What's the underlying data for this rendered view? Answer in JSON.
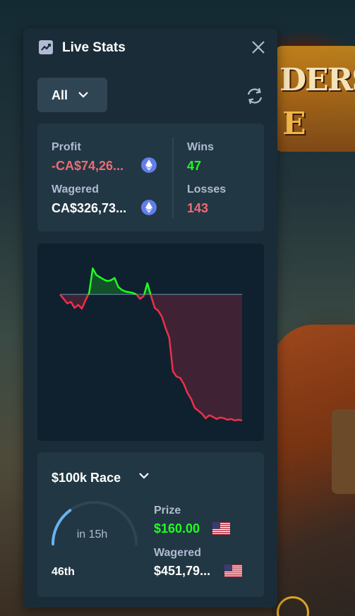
{
  "background": {
    "banner_line1": "DERS",
    "banner_line2": "E"
  },
  "header": {
    "title": "Live Stats",
    "icon": "chart-line-icon",
    "close_icon": "close-icon"
  },
  "filter": {
    "selected": "All",
    "icon": "chevron-down-icon"
  },
  "refresh_icon": "refresh-icon",
  "stats": {
    "profit_label": "Profit",
    "profit_value": "-CA$74,26...",
    "wagered_label": "Wagered",
    "wagered_value": "CA$326,73...",
    "wins_label": "Wins",
    "wins_value": "47",
    "losses_label": "Losses",
    "losses_value": "143",
    "currency_icon": "ethereum-icon"
  },
  "chart_data": {
    "type": "area",
    "title": "",
    "xlabel": "",
    "ylabel": "",
    "baseline": 0,
    "ylim": [
      -17,
      4
    ],
    "x": [
      0,
      1,
      2,
      3,
      4,
      5,
      6,
      7,
      8,
      9,
      10,
      11,
      12,
      13,
      14,
      15,
      16,
      17,
      18,
      19,
      20,
      21,
      22,
      23,
      24,
      25,
      26,
      27,
      28,
      29,
      30,
      31,
      32,
      33,
      34,
      35,
      36,
      37,
      38,
      39,
      40,
      41,
      42,
      43,
      44,
      45,
      46,
      47,
      48,
      49,
      50
    ],
    "values": [
      0,
      -0.6,
      -1.2,
      -1.0,
      -1.8,
      -1.4,
      -1.9,
      -0.8,
      0.2,
      3.5,
      2.6,
      2.3,
      2.0,
      1.8,
      1.9,
      2.2,
      1.0,
      0.6,
      0.4,
      0.3,
      0.2,
      0.0,
      -0.6,
      -0.2,
      1.5,
      -0.2,
      -1.8,
      -2.2,
      -3.0,
      -4.5,
      -5.8,
      -10.3,
      -11.0,
      -11.2,
      -12.0,
      -13.2,
      -14.0,
      -15.2,
      -15.6,
      -16.0,
      -16.6,
      -16.2,
      -16.4,
      -16.7,
      -16.5,
      -16.6,
      -16.8,
      -16.7,
      -16.9,
      -16.8,
      -16.9
    ],
    "colors": {
      "positive": "#1fff20",
      "negative": "#ed2f4d",
      "baseline": "#557086"
    }
  },
  "race": {
    "title": "$100k Race",
    "chevron_icon": "chevron-down-icon",
    "time_left": "in 15h",
    "progress": 0.3,
    "rank": "46th",
    "prize_label": "Prize",
    "prize_value": "$160.00",
    "wagered_label": "Wagered",
    "wagered_value": "$451,79...",
    "flag_icon": "us-flag-icon"
  },
  "colors": {
    "panel": "#1a2c38",
    "card": "#213743",
    "label": "#b1bad3",
    "negative": "#ed6b76",
    "positive": "#1fff20",
    "accent": "#6ab2f0"
  }
}
